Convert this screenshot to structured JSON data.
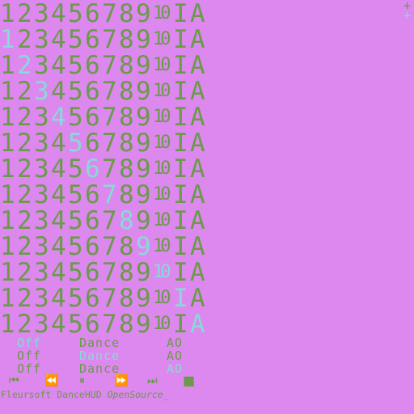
{
  "hud": {
    "glyphs": [
      "1",
      "2",
      "3",
      "4",
      "5",
      "6",
      "7",
      "8",
      "9",
      "10",
      "I",
      "A"
    ],
    "rows_highlight": [
      null,
      0,
      1,
      2,
      3,
      4,
      5,
      6,
      7,
      8,
      9,
      10,
      11
    ],
    "corner": [
      "+",
      "+"
    ]
  },
  "status": [
    {
      "state": "Off",
      "mode": "Dance",
      "anim": "AO",
      "highlight": "state"
    },
    {
      "state": "Off",
      "mode": "Dance",
      "anim": "AO",
      "highlight": "mode"
    },
    {
      "state": "Off",
      "mode": "Dance",
      "anim": "AO",
      "highlight": "anim"
    }
  ],
  "controls": {
    "skip_back": "⏮",
    "rewind": "⏪",
    "pause": "⏸",
    "forward": "⏩",
    "skip_forward": "⏭",
    "stop": "■"
  },
  "footer": {
    "brand": "Fleursoft DanceHUD",
    "tag": "OpenSource",
    "cursor": "_"
  },
  "colors": {
    "background": "#dc88ee",
    "text": "#6b9a4a",
    "highlight": "#8ad8d8"
  }
}
